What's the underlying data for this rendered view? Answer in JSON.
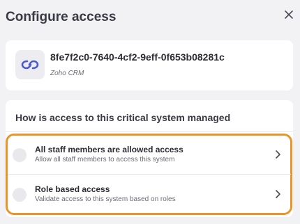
{
  "dialog": {
    "title": "Configure access",
    "close_icon": "close-icon"
  },
  "system": {
    "id": "8fe7f2c0-7640-4cf2-9eff-0f653b08281c",
    "name": "Zoho CRM",
    "icon": "link-icon"
  },
  "question": {
    "title": "How is access to this critical system managed",
    "options": [
      {
        "title": "All staff members are allowed access",
        "description": "Allow all staff members to access this system",
        "icon": "chevron-right-icon"
      },
      {
        "title": "Role based access",
        "description": "Validate access to this system based on roles",
        "icon": "chevron-right-icon"
      }
    ]
  },
  "colors": {
    "background": "#f2f2f4",
    "card": "#ffffff",
    "highlight": "#e8962a",
    "logo": "#4a5bd0"
  }
}
